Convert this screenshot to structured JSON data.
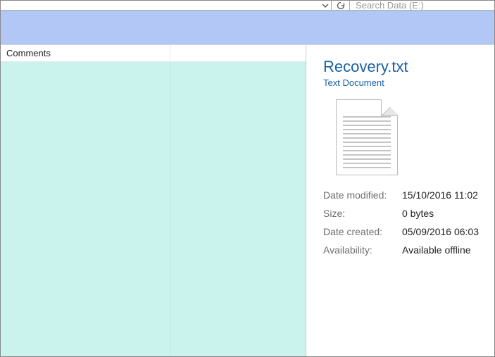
{
  "topbar": {
    "search_placeholder": "Search Data (E:)"
  },
  "columns": {
    "comments": "Comments"
  },
  "preview": {
    "filename": "Recovery.txt",
    "filetype": "Text Document",
    "labels": {
      "date_modified": "Date modified:",
      "size": "Size:",
      "date_created": "Date created:",
      "availability": "Availability:"
    },
    "values": {
      "date_modified": "15/10/2016 11:02",
      "size": "0 bytes",
      "date_created": "05/09/2016 06:03",
      "availability": "Available offline"
    }
  }
}
